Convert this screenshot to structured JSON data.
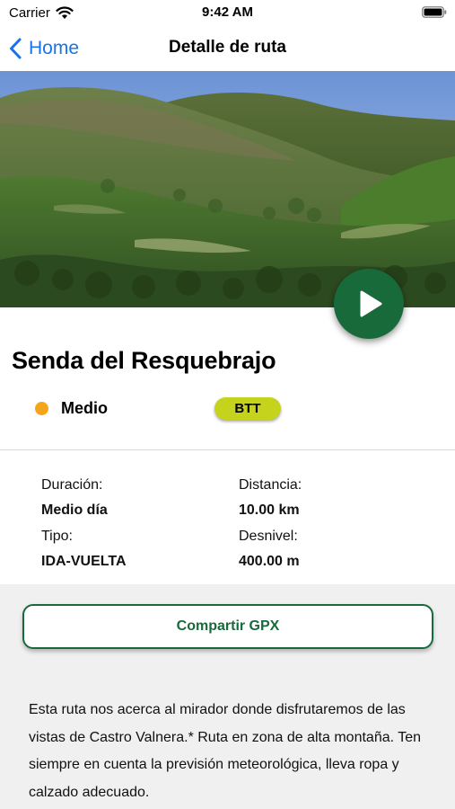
{
  "status_bar": {
    "carrier": "Carrier",
    "time": "9:42 AM"
  },
  "nav": {
    "back_label": "Home",
    "title": "Detalle de ruta"
  },
  "route": {
    "name": "Senda del Resquebrajo",
    "difficulty": {
      "label": "Medio",
      "color": "#f5a51c"
    },
    "activity_badge": "BTT"
  },
  "details": {
    "duration_label": "Duración:",
    "duration_value": "Medio día",
    "distance_label": "Distancia:",
    "distance_value": "10.00 km",
    "type_label": "Tipo:",
    "type_value": "IDA-VUELTA",
    "elevation_label": "Desnivel:",
    "elevation_value": "400.00 m"
  },
  "actions": {
    "share_gpx_label": "Compartir GPX"
  },
  "description": "Esta ruta nos acerca al mirador donde disfrutaremos de las vistas de Castro Valnera.* Ruta en zona de alta montaña. Ten siempre en cuenta la previsión meteorológica, lleva ropa y calzado adecuado.",
  "colors": {
    "accent_green": "#186a3b",
    "link_blue": "#1a73e8",
    "badge_lime": "#c6d31c"
  },
  "icons": [
    "wifi-icon",
    "battery-icon",
    "chevron-left-icon",
    "play-icon"
  ]
}
